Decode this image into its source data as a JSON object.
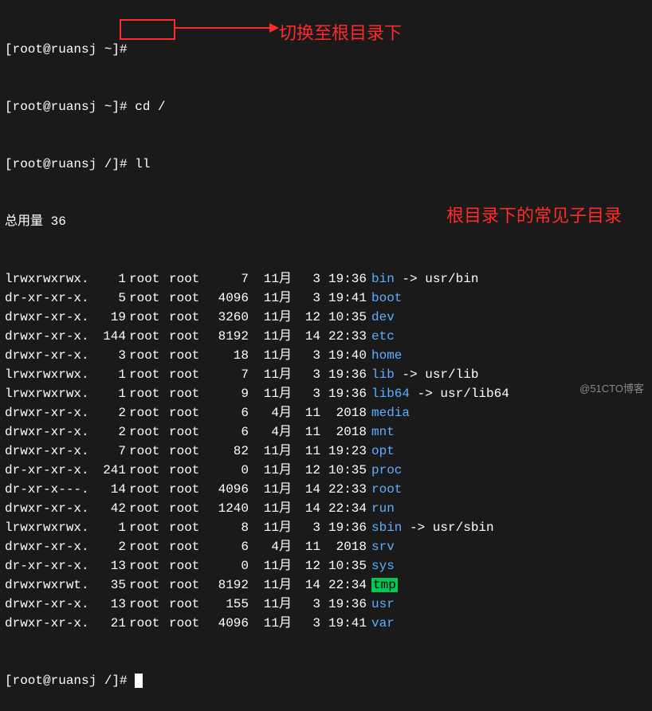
{
  "prompts": {
    "p1_prefix": "[root@ruansj ~]#",
    "p1_cmd": "",
    "p2_prefix": "[root@ruansj ~]#",
    "p2_cmd": " cd /",
    "p3_prefix": "[root@ruansj /]#",
    "p3_cmd": " ll",
    "total": "总用量 36",
    "p4_prefix": "[root@ruansj /]# "
  },
  "annotations": {
    "top": "切换至根目录下",
    "side": "根目录下的常见子目录"
  },
  "watermark": "@51CTO博客",
  "files": [
    {
      "perm": "lrwxrwxrwx.",
      "links": "1",
      "own": "root",
      "grp": "root",
      "size": "7",
      "mon": "11月",
      "day": "3",
      "time": "19:36",
      "name": "bin",
      "target": "usr/bin",
      "dir": false,
      "link": true
    },
    {
      "perm": "dr-xr-xr-x.",
      "links": "5",
      "own": "root",
      "grp": "root",
      "size": "4096",
      "mon": "11月",
      "day": "3",
      "time": "19:41",
      "name": "boot",
      "dir": true
    },
    {
      "perm": "drwxr-xr-x.",
      "links": "19",
      "own": "root",
      "grp": "root",
      "size": "3260",
      "mon": "11月",
      "day": "12",
      "time": "10:35",
      "name": "dev",
      "dir": true
    },
    {
      "perm": "drwxr-xr-x.",
      "links": "144",
      "own": "root",
      "grp": "root",
      "size": "8192",
      "mon": "11月",
      "day": "14",
      "time": "22:33",
      "name": "etc",
      "dir": true
    },
    {
      "perm": "drwxr-xr-x.",
      "links": "3",
      "own": "root",
      "grp": "root",
      "size": "18",
      "mon": "11月",
      "day": "3",
      "time": "19:40",
      "name": "home",
      "dir": true
    },
    {
      "perm": "lrwxrwxrwx.",
      "links": "1",
      "own": "root",
      "grp": "root",
      "size": "7",
      "mon": "11月",
      "day": "3",
      "time": "19:36",
      "name": "lib",
      "target": "usr/lib",
      "dir": false,
      "link": true
    },
    {
      "perm": "lrwxrwxrwx.",
      "links": "1",
      "own": "root",
      "grp": "root",
      "size": "9",
      "mon": "11月",
      "day": "3",
      "time": "19:36",
      "name": "lib64",
      "target": "usr/lib64",
      "dir": false,
      "link": true
    },
    {
      "perm": "drwxr-xr-x.",
      "links": "2",
      "own": "root",
      "grp": "root",
      "size": "6",
      "mon": "4月",
      "day": "11",
      "time": "2018",
      "name": "media",
      "dir": true
    },
    {
      "perm": "drwxr-xr-x.",
      "links": "2",
      "own": "root",
      "grp": "root",
      "size": "6",
      "mon": "4月",
      "day": "11",
      "time": "2018",
      "name": "mnt",
      "dir": true
    },
    {
      "perm": "drwxr-xr-x.",
      "links": "7",
      "own": "root",
      "grp": "root",
      "size": "82",
      "mon": "11月",
      "day": "11",
      "time": "19:23",
      "name": "opt",
      "dir": true
    },
    {
      "perm": "dr-xr-xr-x.",
      "links": "241",
      "own": "root",
      "grp": "root",
      "size": "0",
      "mon": "11月",
      "day": "12",
      "time": "10:35",
      "name": "proc",
      "dir": true
    },
    {
      "perm": "dr-xr-x---.",
      "links": "14",
      "own": "root",
      "grp": "root",
      "size": "4096",
      "mon": "11月",
      "day": "14",
      "time": "22:33",
      "name": "root",
      "dir": true
    },
    {
      "perm": "drwxr-xr-x.",
      "links": "42",
      "own": "root",
      "grp": "root",
      "size": "1240",
      "mon": "11月",
      "day": "14",
      "time": "22:34",
      "name": "run",
      "dir": true
    },
    {
      "perm": "lrwxrwxrwx.",
      "links": "1",
      "own": "root",
      "grp": "root",
      "size": "8",
      "mon": "11月",
      "day": "3",
      "time": "19:36",
      "name": "sbin",
      "target": "usr/sbin",
      "dir": false,
      "link": true
    },
    {
      "perm": "drwxr-xr-x.",
      "links": "2",
      "own": "root",
      "grp": "root",
      "size": "6",
      "mon": "4月",
      "day": "11",
      "time": "2018",
      "name": "srv",
      "dir": true
    },
    {
      "perm": "dr-xr-xr-x.",
      "links": "13",
      "own": "root",
      "grp": "root",
      "size": "0",
      "mon": "11月",
      "day": "12",
      "time": "10:35",
      "name": "sys",
      "dir": true
    },
    {
      "perm": "drwxrwxrwt.",
      "links": "35",
      "own": "root",
      "grp": "root",
      "size": "8192",
      "mon": "11月",
      "day": "14",
      "time": "22:34",
      "name": "tmp",
      "dir": true,
      "sticky": true
    },
    {
      "perm": "drwxr-xr-x.",
      "links": "13",
      "own": "root",
      "grp": "root",
      "size": "155",
      "mon": "11月",
      "day": "3",
      "time": "19:36",
      "name": "usr",
      "dir": true
    },
    {
      "perm": "drwxr-xr-x.",
      "links": "21",
      "own": "root",
      "grp": "root",
      "size": "4096",
      "mon": "11月",
      "day": "3",
      "time": "19:41",
      "name": "var",
      "dir": true
    }
  ]
}
